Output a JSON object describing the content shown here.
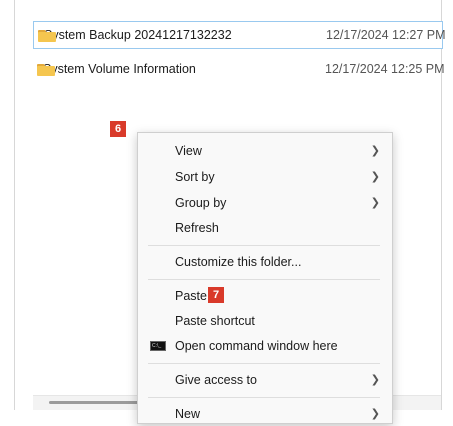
{
  "files": [
    {
      "name": "System Backup 20241217132232",
      "date": "12/17/2024 12:27 PM",
      "icon": "folder-icon"
    },
    {
      "name": "System Volume Information",
      "date": "12/17/2024 12:25 PM",
      "icon": "folder-icon"
    }
  ],
  "badges": {
    "step6": "6",
    "step7": "7"
  },
  "context_menu": {
    "view": "View",
    "sort_by": "Sort by",
    "group_by": "Group by",
    "refresh": "Refresh",
    "customize": "Customize this folder...",
    "paste": "Paste",
    "paste_shortcut": "Paste shortcut",
    "open_cmd": "Open command window here",
    "give_access": "Give access to",
    "new": "New"
  },
  "colors": {
    "badge": "#d93a2a",
    "selection_border": "#99c9ef",
    "folder": "#f5c64f"
  }
}
